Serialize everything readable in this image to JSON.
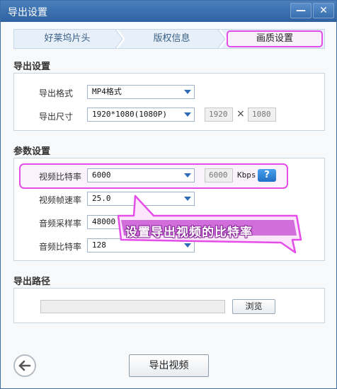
{
  "window": {
    "title": "导出设置",
    "minimize_label": "—",
    "close_label": "✕"
  },
  "tabs": [
    {
      "label": "好莱坞片头"
    },
    {
      "label": "版权信息"
    },
    {
      "label": "画质设置"
    }
  ],
  "export_settings": {
    "section_title": "导出设置",
    "format_label": "导出格式",
    "format_value": "MP4格式",
    "size_label": "导出尺寸",
    "size_value": "1920*1080(1080P)",
    "width_value": "1920",
    "height_value": "1080",
    "times_sign": "×"
  },
  "param_settings": {
    "section_title": "参数设置",
    "video_bitrate_label": "视频比特率",
    "video_bitrate_value": "6000",
    "video_bitrate_field": "6000",
    "bitrate_unit": "Kbps",
    "help_label": "?",
    "framerate_label": "视频帧速率",
    "framerate_value": "25.0",
    "audio_samplerate_label": "音频采样率",
    "audio_samplerate_value": "48000",
    "audio_bitrate_label": "音频比特率",
    "audio_bitrate_value": "128"
  },
  "annotation": {
    "text": "设置导出视频的比特率",
    "color": "#e44de8"
  },
  "export_path": {
    "section_title": "导出路径",
    "path_value": "",
    "browse_label": "浏览"
  },
  "footer": {
    "export_button_label": "导出视频"
  },
  "colors": {
    "accent": "#2f6cb8",
    "highlight": "#e44de8"
  }
}
